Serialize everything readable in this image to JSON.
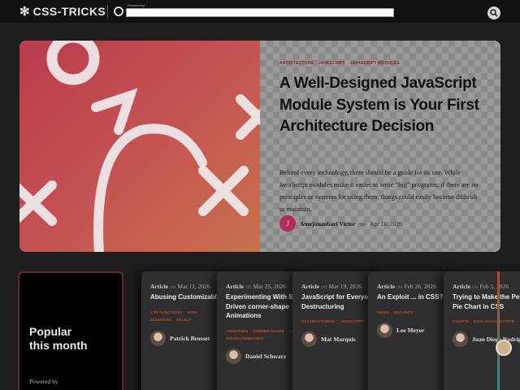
{
  "header": {
    "logo_star": "✻",
    "logo_text": "CSS-TRICKS",
    "sponsor_label": "Powered by",
    "search_icon": "search-icon"
  },
  "hero": {
    "tags": [
      "Architecture",
      "JavaScript",
      "JavaScript Modules"
    ],
    "title": "A Well-Designed JavaScript Module System is Your First Architecture Decision",
    "excerpt": "Behind every technology, there should be a guide for its use. While JavaScript modules make it easier to write “big” programs, if there are no principles or systems for using them, things could easily become difficult to maintain.",
    "avatar_letter": "J",
    "author": "Amejimaobari Victor",
    "date_prefix": "on",
    "date": "Apr 16, 2026",
    "art_colors": {
      "from": "#b93c4c",
      "to": "#c9714e"
    }
  },
  "popular": {
    "title": "Popular this month",
    "powered": "Powered by"
  },
  "cards": [
    {
      "type": "Article",
      "on": "on",
      "date": "Mar 11, 2026",
      "title": "Abusing Customizable",
      "tags": [
        "CSS Functions",
        "HTML Elements",
        "Select"
      ],
      "author": "Patrick Brosset"
    },
    {
      "type": "Article",
      "on": "on",
      "date": "Mar 25, 2026",
      "title": "Experimenting With Scroll-Driven corner-shape Animations",
      "tags": [
        "Animation",
        "Corner-Shape",
        "Scroll Driven Animation"
      ],
      "author": "Daniel Schwarz"
    },
    {
      "type": "Article",
      "on": "on",
      "date": "Mar 19, 2026",
      "title": "JavaScript for Everyone: Destructuring",
      "tags": [
        "Destructuring",
        "JavaScript"
      ],
      "author": "Mat Marquis"
    },
    {
      "type": "Article",
      "on": "on",
      "date": "Feb 26, 2026",
      "title": "An Exploit ... in CSS?!",
      "tags": [
        "News",
        "Security"
      ],
      "author": "Lee Meyer"
    },
    {
      "type": "Article",
      "on": "on",
      "date": "Feb 5, 2026",
      "title": "Trying to Make the Perfect Pie Chart in CSS",
      "tags": [
        "Charts",
        "Data Visualization"
      ],
      "author": "Juan Diego Rodríguez"
    }
  ],
  "colors": {
    "accent": "#c0461e",
    "tag_dark": "#8c2414",
    "background": "#1e1e1e"
  }
}
